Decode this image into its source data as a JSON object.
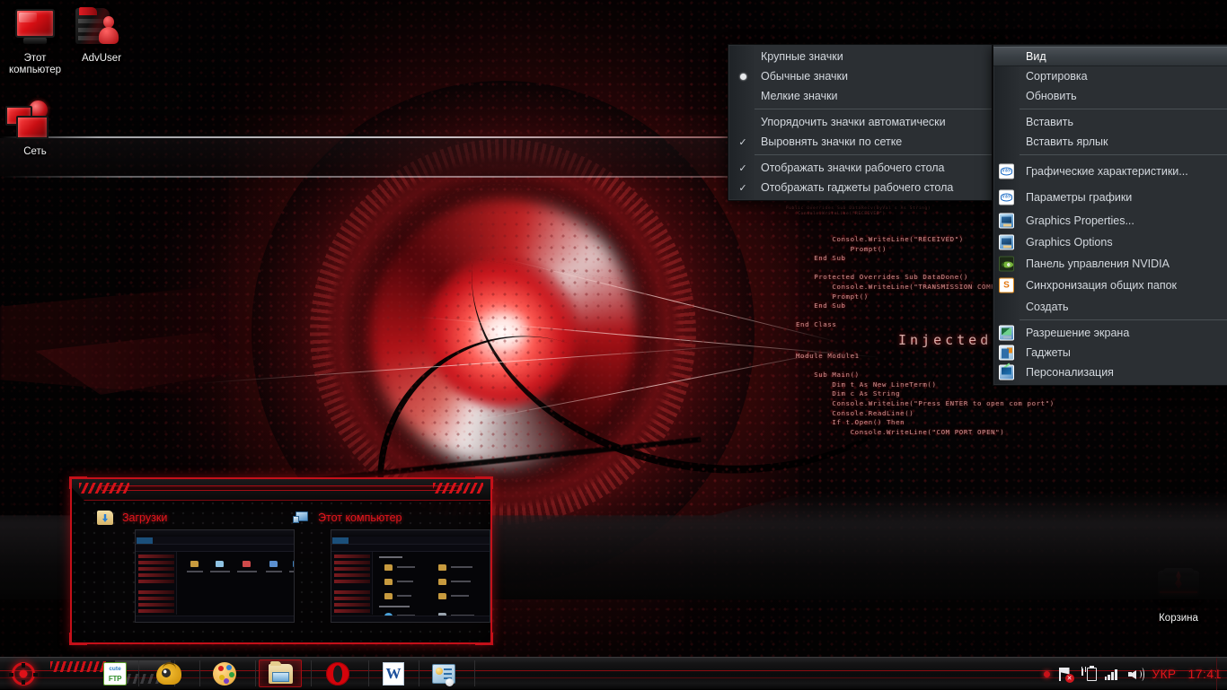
{
  "desktop": {
    "icons": [
      {
        "id": "this-computer",
        "label": "Этот\nкомпьютер",
        "label_line1": "Этот",
        "label_line2": "компьютер",
        "icon": "monitor-icon"
      },
      {
        "id": "advuser",
        "label": "AdvUser",
        "icon": "user-folder-icon"
      },
      {
        "id": "network",
        "label": "Сеть",
        "icon": "network-icon"
      },
      {
        "id": "recycle-bin",
        "label": "Корзина",
        "icon": "recycle-bin-icon"
      }
    ],
    "wallpaper_code": {
      "block1": "        Console.WriteLine(\"RECEIVED\")\n            Prompt()\n    End Sub\n\n    Protected Overrides Sub DataDone()\n        Console.WriteLine(\"TRANSMISSION COMPLETE\")\n        Prompt()\n    End Sub\n\nEnd Class",
      "block2": "Module Module1\n\n    Sub Main()\n        Dim t As New LineTerm()\n        Dim c As String\n        Console.WriteLine(\"Press ENTER to open com port\")\n        Console.ReadLine()\n        If t.Open() Then\n            Console.WriteLine(\"COM PORT OPEN\")",
      "injected": "Injected"
    }
  },
  "view_submenu": {
    "name": "view-submenu",
    "items": [
      {
        "label": "Крупные значки",
        "mark": "none"
      },
      {
        "label": "Обычные значки",
        "mark": "radio"
      },
      {
        "label": "Мелкие значки",
        "mark": "none"
      },
      {
        "separator_after": true
      },
      {
        "label": "Упорядочить значки автоматически",
        "mark": "none"
      },
      {
        "label": "Выровнять значки по сетке",
        "mark": "check"
      },
      {
        "separator_after": true
      },
      {
        "label": "Отображать значки рабочего стола",
        "mark": "check"
      },
      {
        "label": "Отображать гаджеты  рабочего стола",
        "mark": "check"
      }
    ]
  },
  "context_menu": {
    "name": "desktop-context-menu",
    "items": [
      {
        "label": "Вид",
        "arrow": true,
        "selected": true,
        "icon": "none"
      },
      {
        "label": "Сортировка",
        "arrow": true,
        "icon": "none"
      },
      {
        "label": "Обновить",
        "arrow": false,
        "icon": "none"
      },
      {
        "label": "Вставить",
        "arrow": false,
        "icon": "none"
      },
      {
        "label": "Вставить ярлык",
        "arrow": false,
        "icon": "none"
      },
      {
        "label": "Графические характеристики...",
        "arrow": false,
        "icon": "intel-icon"
      },
      {
        "label": "Параметры графики",
        "arrow": true,
        "icon": "intel-icon"
      },
      {
        "label": "Graphics Properties...",
        "arrow": false,
        "icon": "graphics-icon"
      },
      {
        "label": "Graphics Options",
        "arrow": true,
        "icon": "graphics-icon"
      },
      {
        "label": "Панель управления NVIDIA",
        "arrow": false,
        "icon": "nvidia-icon"
      },
      {
        "label": "Синхронизация общих папок",
        "arrow": true,
        "icon": "sync-icon"
      },
      {
        "label": "Создать",
        "arrow": true,
        "icon": "none"
      },
      {
        "label": "Разрешение экрана",
        "arrow": false,
        "icon": "screen-resolution-icon"
      },
      {
        "label": "Гаджеты",
        "arrow": false,
        "icon": "gadgets-icon"
      },
      {
        "label": "Персонализация",
        "arrow": false,
        "icon": "personalization-icon"
      }
    ]
  },
  "taskbar_preview": {
    "name": "taskbar-thumbnail-preview",
    "thumbnails": [
      {
        "title": "Загрузки",
        "icon": "downloads-folder-icon"
      },
      {
        "title": "Этот компьютер",
        "icon": "this-computer-icon"
      }
    ]
  },
  "taskbar": {
    "start_button": "start-orb",
    "buttons": [
      {
        "id": "cuteftp",
        "label": "CuteFTP",
        "icon": "cuteftp-icon",
        "active": false
      },
      {
        "id": "worm",
        "label": "ACDSee",
        "icon": "eye-worm-icon",
        "active": false
      },
      {
        "id": "paint",
        "label": "Paint",
        "icon": "paint-palette-icon",
        "active": false
      },
      {
        "id": "explorer",
        "label": "Проводник",
        "icon": "explorer-folder-icon",
        "active": true
      },
      {
        "id": "opera",
        "label": "Opera",
        "icon": "opera-icon",
        "active": false
      },
      {
        "id": "word",
        "label": "Word",
        "icon": "word-icon",
        "active": false
      },
      {
        "id": "config",
        "label": "Настройки",
        "icon": "settings-icon",
        "active": false
      }
    ],
    "tray": {
      "network_icon": "network-disconnected-icon",
      "battery_icon": "battery-plugged-icon",
      "signal_icon": "signal-bars-icon",
      "volume_icon": "volume-icon",
      "language": "УКР",
      "clock": "17:41"
    }
  },
  "colors": {
    "accent_red": "#d0161d",
    "menu_bg": "#2b2f33",
    "menu_text": "#d3d8de",
    "taskbar_text_red": "#e0141b"
  }
}
